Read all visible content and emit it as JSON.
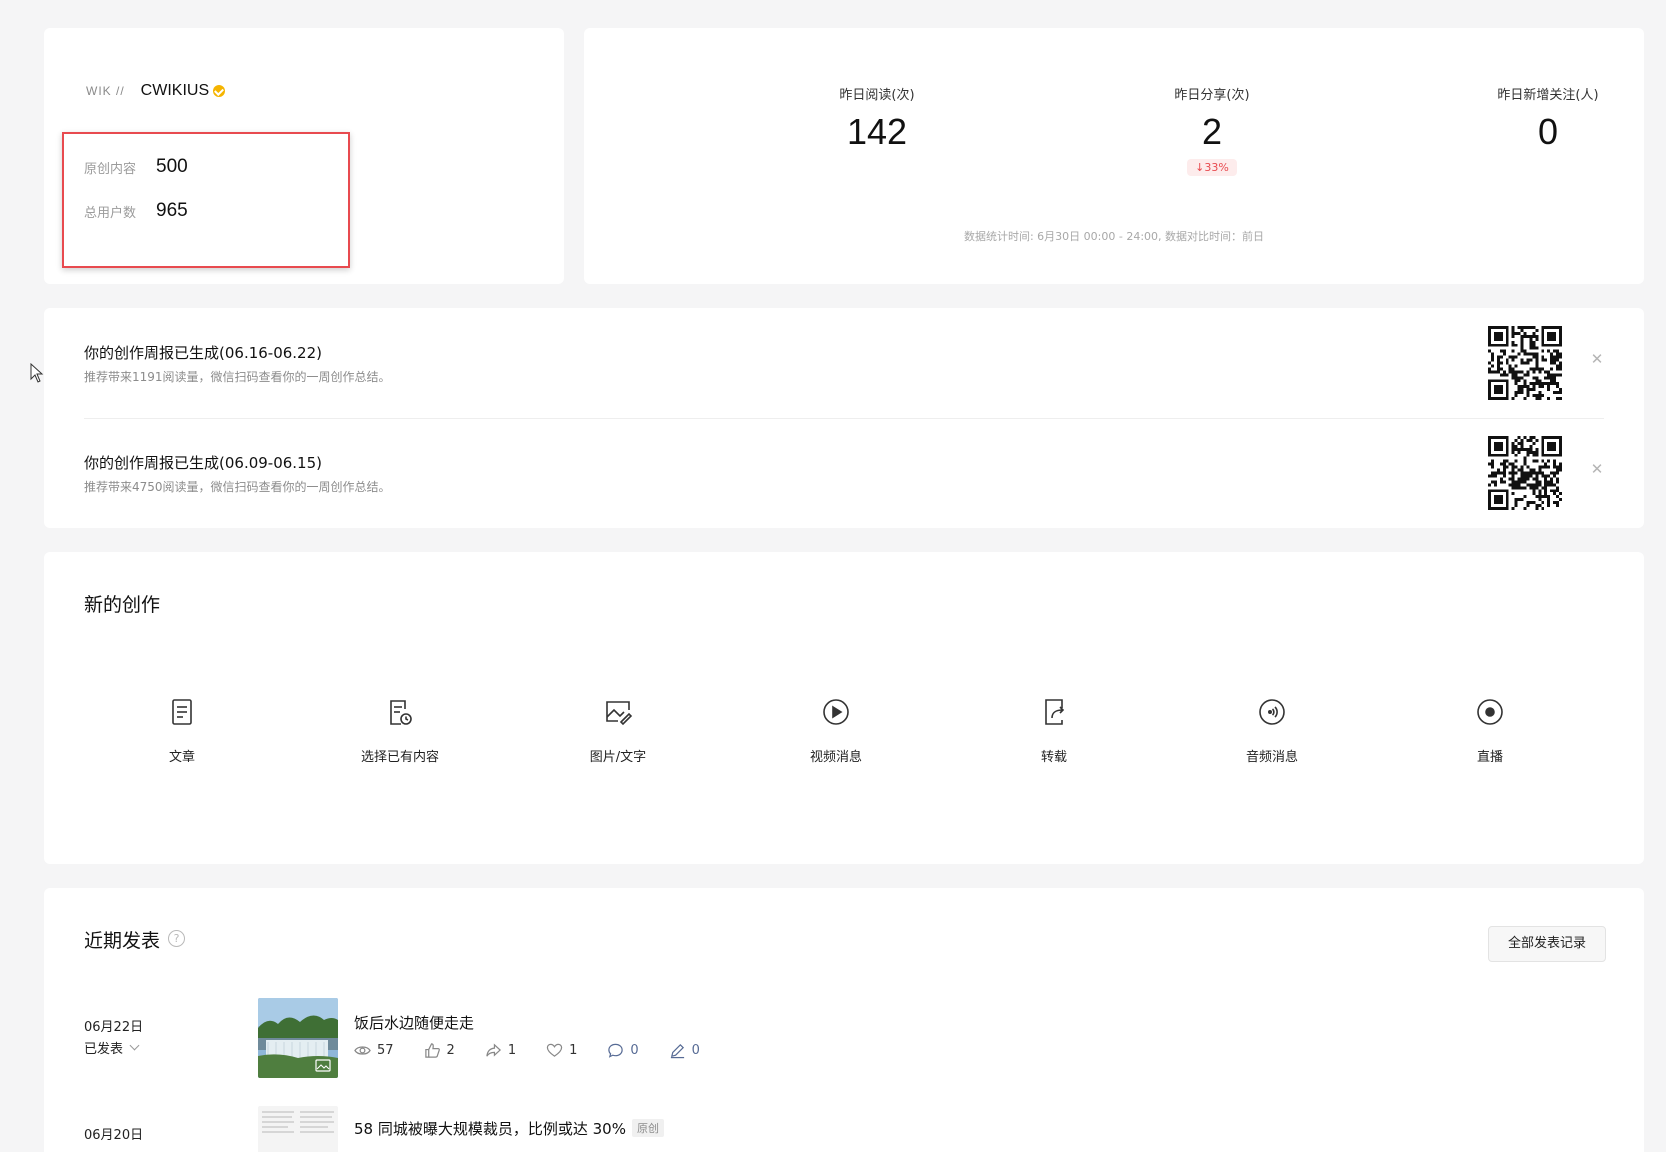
{
  "account": {
    "logo_text": "WIK //",
    "name": "CWIKIUS",
    "original_label": "原创内容",
    "original_value": "500",
    "users_label": "总用户数",
    "users_value": "965"
  },
  "yesterday": {
    "reads_label": "昨日阅读(次)",
    "reads_value": "142",
    "shares_label": "昨日分享(次)",
    "shares_value": "2",
    "shares_delta": "↓33%",
    "follows_label": "昨日新增关注(人)",
    "follows_value": "0",
    "note": "数据统计时间: 6月30日 00:00 - 24:00, 数据对比时间：前日"
  },
  "reports": [
    {
      "title": "你的创作周报已生成(06.16-06.22)",
      "desc": "推荐带来1191阅读量，微信扫码查看你的一周创作总结。"
    },
    {
      "title": "你的创作周报已生成(06.09-06.15)",
      "desc": "推荐带来4750阅读量，微信扫码查看你的一周创作总结。"
    }
  ],
  "create": {
    "title": "新的创作",
    "items": [
      {
        "label": "文章",
        "icon": "article-icon"
      },
      {
        "label": "选择已有内容",
        "icon": "existing-content-icon"
      },
      {
        "label": "图片/文字",
        "icon": "image-text-icon"
      },
      {
        "label": "视频消息",
        "icon": "video-icon"
      },
      {
        "label": "转载",
        "icon": "repost-icon"
      },
      {
        "label": "音频消息",
        "icon": "audio-icon"
      },
      {
        "label": "直播",
        "icon": "live-icon"
      }
    ]
  },
  "recent": {
    "title": "近期发表",
    "help": "?",
    "all_button": "全部发表记录",
    "posts": [
      {
        "date": "06月22日",
        "status": "已发表",
        "title": "饭后水边随便走走",
        "views": "57",
        "likes": "2",
        "shares": "1",
        "favs": "1",
        "comments": "0",
        "edits": "0"
      },
      {
        "date": "06月20日",
        "title": "58 同城被曝大规模裁员，比例或达 30%",
        "badge": "原创"
      }
    ]
  },
  "colors": {
    "accent_red": "#e84a4f",
    "verified": "#f5b400",
    "link_blue": "#576b95"
  }
}
